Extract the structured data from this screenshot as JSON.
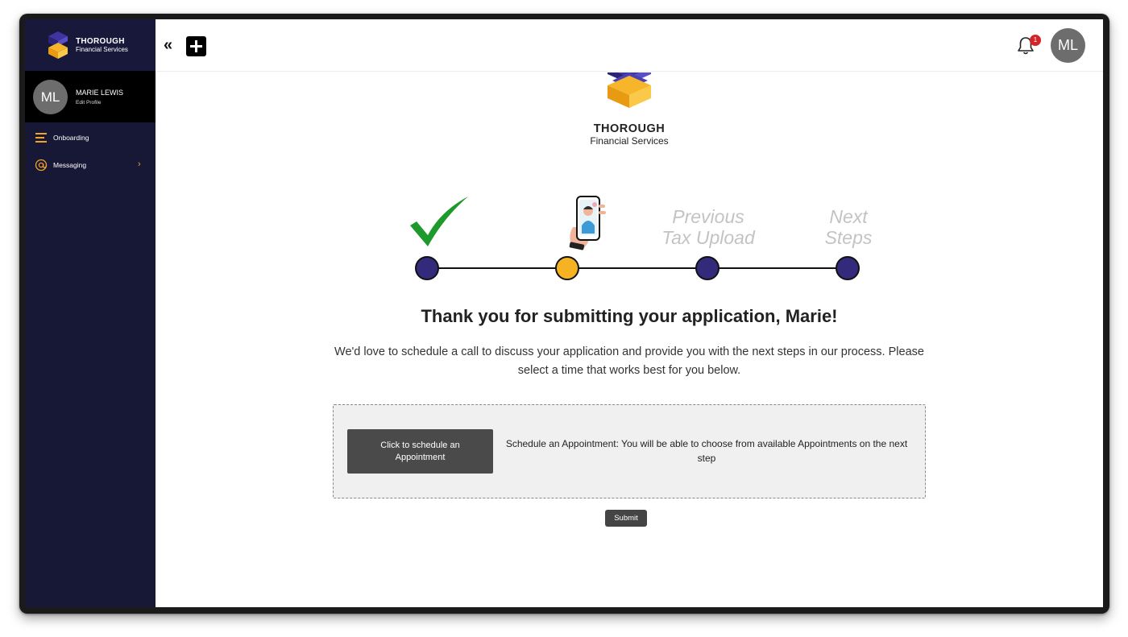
{
  "sidebar": {
    "brand_name": "THOROUGH",
    "brand_sub": "Financial Services",
    "profile": {
      "initials": "ML",
      "name": "MARIE LEWIS",
      "edit_label": "Edit Profile"
    },
    "items": [
      {
        "label": "Onboarding",
        "icon": "menu-lines-icon"
      },
      {
        "label": "Messaging",
        "icon": "at-sign-icon"
      }
    ]
  },
  "topbar": {
    "collapse_glyph": "«",
    "notification_count": "1",
    "avatar_initials": "ML"
  },
  "main": {
    "brand_name": "THOROUGH",
    "brand_sub": "Financial Services",
    "steps": [
      {
        "label": "",
        "status": "completed",
        "marker": "checkmark-icon"
      },
      {
        "label": "",
        "status": "current",
        "marker": "phone-hand-icon"
      },
      {
        "label_line1": "Previous",
        "label_line2": "Tax Upload",
        "status": "upcoming"
      },
      {
        "label_line1": "Next",
        "label_line2": "Steps",
        "status": "upcoming"
      }
    ],
    "thank_you": "Thank you for submitting your application, Marie!",
    "intro_line1": "We'd love to schedule a call to discuss your application and provide you with the next steps in our process. Please",
    "intro_line2": "select a time that works best for you below.",
    "schedule": {
      "button_label": "Click to schedule an Appointment",
      "description": "Schedule an Appointment: You will be able to choose from available Appointments on the next step"
    },
    "submit_label": "Submit"
  },
  "colors": {
    "sidebar_bg": "#171736",
    "accent_orange": "#f0a52a",
    "step_dot": "#332a7c",
    "step_current": "#f5b323",
    "check_green": "#1e9a2c",
    "badge_red": "#d3242a"
  }
}
